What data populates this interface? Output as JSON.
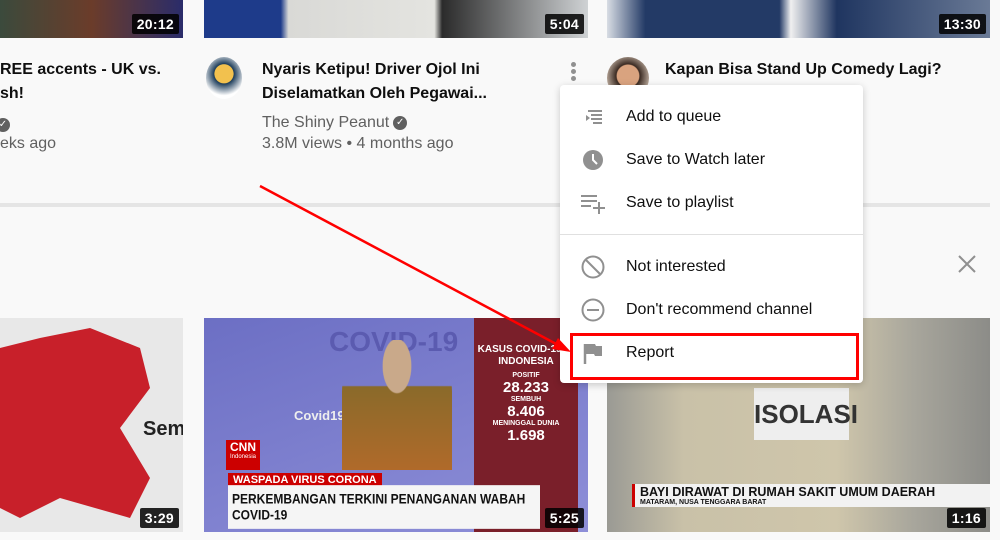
{
  "top_row": [
    {
      "duration": "20:12",
      "title_lines": [
        "REE accents - UK vs.",
        "sh!"
      ],
      "meta_line": "eks ago"
    },
    {
      "duration": "5:04",
      "title_lines": [
        "Nyaris Ketipu! Driver Ojol Ini",
        "Diselamatkan Oleh Pegawai..."
      ],
      "channel": "The Shiny Peanut",
      "stats": "3.8M views • 4 months ago"
    },
    {
      "duration": "13:30",
      "title": "Kapan Bisa Stand Up Comedy Lagi?"
    }
  ],
  "menu": {
    "items": [
      {
        "label": "Add to queue",
        "icon": "queue-icon"
      },
      {
        "label": "Save to Watch later",
        "icon": "clock-icon"
      },
      {
        "label": "Save to playlist",
        "icon": "playlist-add-icon"
      },
      {
        "label": "Not interested",
        "icon": "block-icon"
      },
      {
        "label": "Don't recommend channel",
        "icon": "minus-circle-icon"
      },
      {
        "label": "Report",
        "icon": "flag-icon"
      }
    ],
    "highlight_color": "#ff0000"
  },
  "bottom_row": [
    {
      "duration": "3:29",
      "overlay": "Sem"
    },
    {
      "duration": "5:25",
      "overlay_title": "COVID-19",
      "side_header": "KASUS COVID-19 DI INDONESIA",
      "stats": [
        {
          "label": "POSITIF",
          "value": "28.233"
        },
        {
          "label": "SEMBUH",
          "value": "8.406"
        },
        {
          "label": "MENINGGAL DUNIA",
          "value": "1.698"
        }
      ],
      "brand": "CNN",
      "brand_sub": "Indonesia",
      "kicker": "WASPADA VIRUS CORONA",
      "headline": "PERKEMBANGAN TERKINI PENANGANAN WABAH COVID-19",
      "site": "Covid19.go.id"
    },
    {
      "duration": "1:16",
      "sign": "ISOLASI",
      "headline": "BAYI DIRAWAT DI RUMAH SAKIT UMUM DAERAH",
      "subline": "MATARAM, NUSA TENGGARA BARAT"
    }
  ]
}
